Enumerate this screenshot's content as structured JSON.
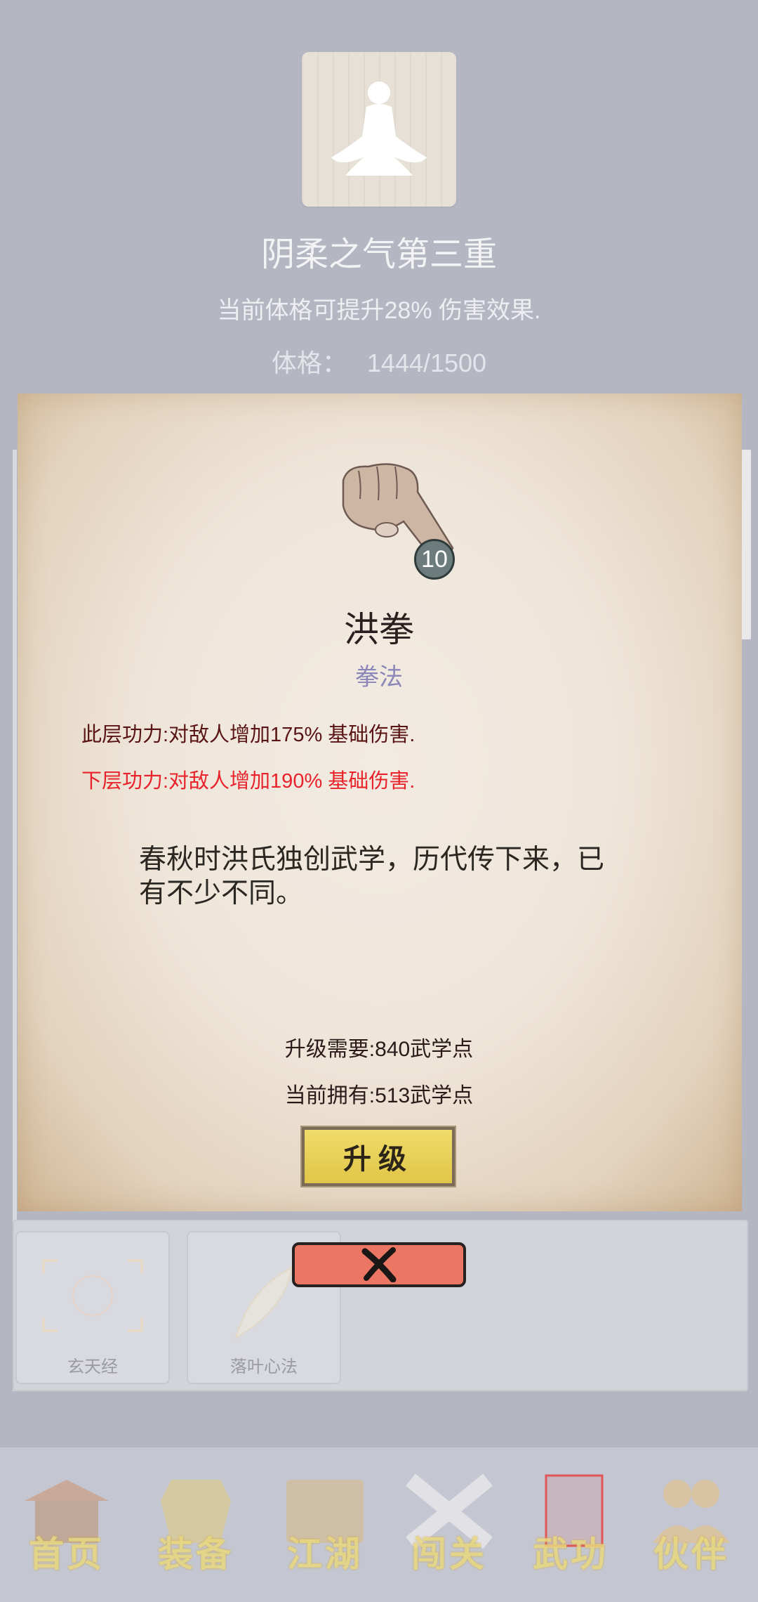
{
  "header": {
    "title": "阴柔之气第三重",
    "subtitle": "当前体格可提升28% 伤害效果.",
    "stat_label": "体格：",
    "stat_value": "1444/1500",
    "avatar_icon": "meditation-icon"
  },
  "skill": {
    "icon": "fist-icon",
    "level": "10",
    "name": "洪拳",
    "type": "拳法",
    "current_effect": "此层功力:对敌人增加175% 基础伤害.",
    "next_effect": "下层功力:对敌人增加190% 基础伤害.",
    "description": "春秋时洪氏独创武学，历代传下来，已有不少不同。",
    "upgrade_need": "升级需要:840武学点",
    "current_have": "当前拥有:513武学点",
    "upgrade_label": "升级",
    "colors": {
      "current_effect": "#5a1414",
      "next_effect": "#e8232b",
      "type": "#8a87b8"
    }
  },
  "close": {
    "icon": "close-icon"
  },
  "background_skills": [
    {
      "name": "玄天经"
    },
    {
      "name": "落叶心法"
    }
  ],
  "nav": [
    {
      "label": "首页"
    },
    {
      "label": "装备"
    },
    {
      "label": "江湖"
    },
    {
      "label": "闯关"
    },
    {
      "label": "武功"
    },
    {
      "label": "伙伴"
    }
  ]
}
